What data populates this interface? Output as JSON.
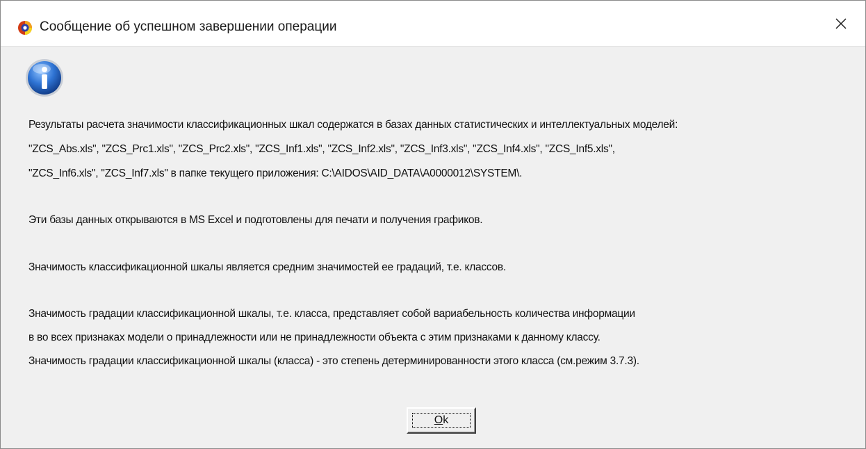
{
  "window": {
    "title": "Сообщение об успешном завершении операции"
  },
  "icons": {
    "app": "aidos-app-icon",
    "close": "close-icon",
    "message": "info-icon"
  },
  "message": {
    "lines": [
      "Результаты расчета значимости классификационных шкал содержатся в базах данных статистических и интеллектуальных моделей:",
      "\"ZCS_Abs.xls\", \"ZCS_Prc1.xls\", \"ZCS_Prc2.xls\", \"ZCS_Inf1.xls\", \"ZCS_Inf2.xls\", \"ZCS_Inf3.xls\", \"ZCS_Inf4.xls\", \"ZCS_Inf5.xls\",",
      "\"ZCS_Inf6.xls\", \"ZCS_Inf7.xls\" в папке текущего приложения: C:\\AIDOS\\AID_DATA\\A0000012\\SYSTEM\\.",
      "Эти базы данных открываются в MS Excel и подготовлены для печати и получения графиков.",
      "Значимость классификационной шкалы является средним значимостей ее градаций, т.е. классов.",
      "Значимость градации классификационной шкалы, т.е. класса, представляет собой вариабельность количества информации",
      "в во всех признаках модели о принадлежности или не принадлежности объекта с этим признаками к данному классу.",
      "Значимость градации классификационной шкалы (класса) - это степень детерминированности этого класса (см.режим 3.7.3)."
    ]
  },
  "buttons": {
    "ok_mnemonic": "O",
    "ok_rest": "k"
  },
  "colors": {
    "dialog_bg": "#f0f0f0",
    "titlebar_bg": "#ffffff",
    "info_blue": "#1f5fb8"
  }
}
